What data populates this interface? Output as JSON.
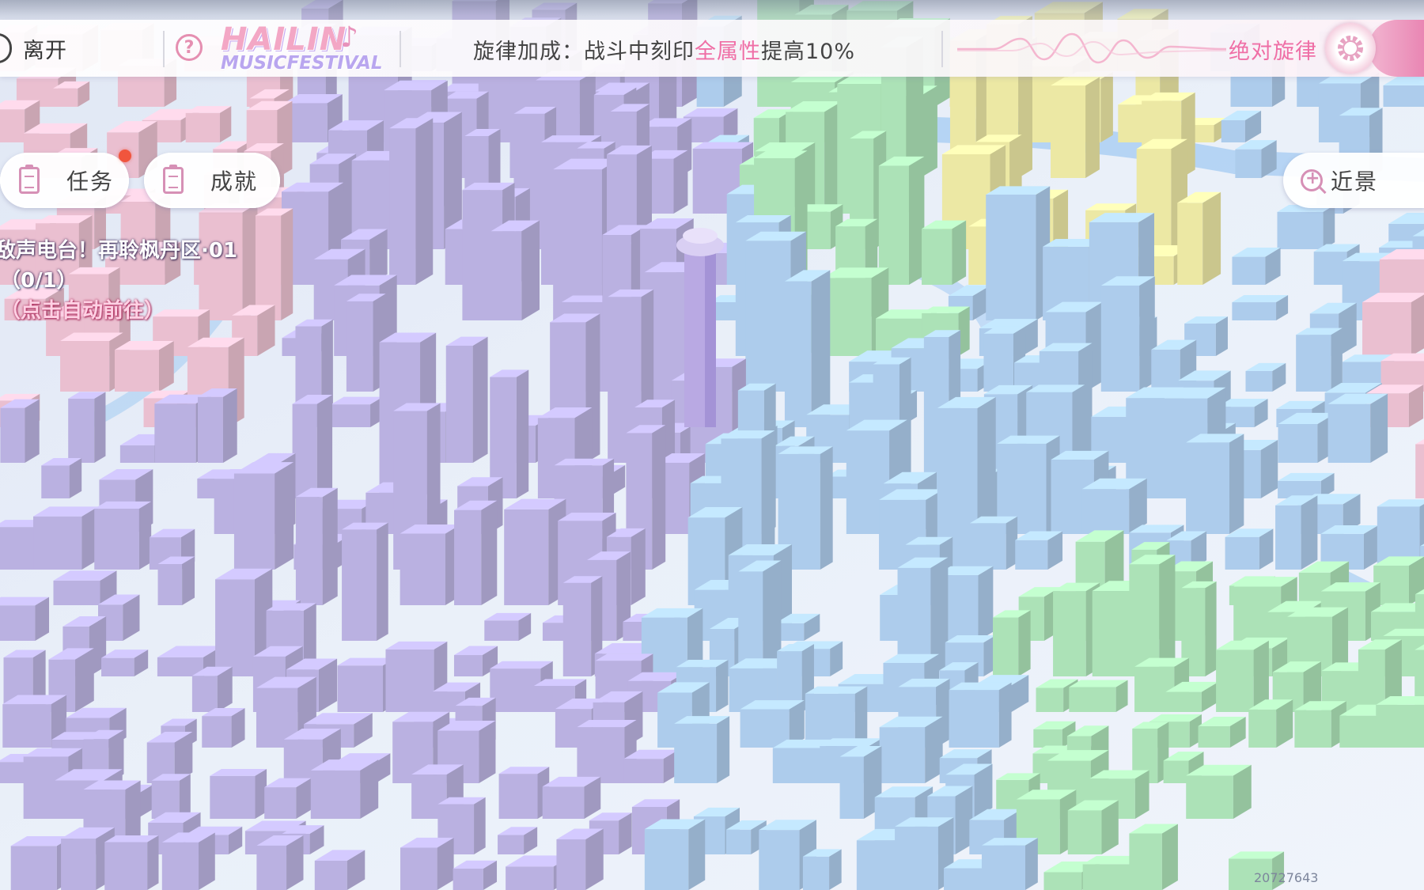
{
  "topbar": {
    "exit_label": "离开",
    "logo_line1": "HAILIN",
    "logo_line2": "MUSICFESTIVAL",
    "bonus_prefix": "旋律加成：战斗中刻印",
    "bonus_highlight": "全属性",
    "bonus_suffix": "提高10%",
    "mode_label": "绝对旋律"
  },
  "left_panel": {
    "tasks_label": "任务",
    "achievements_label": "成就",
    "quest_title": "敌声电台！再聆枫丹区·01",
    "quest_progress": "（0/1）",
    "quest_action": "（点击自动前往）"
  },
  "zoom": {
    "label": "近景"
  },
  "footer": {
    "uid": "20727643"
  },
  "colors": {
    "accent_pink": "#ef6fa6",
    "notification_red": "#f0553d",
    "district_purple": "#b8aee6",
    "district_blue": "#a9cdf4",
    "district_green": "#a8e8b4",
    "district_yellow": "#f4ef9e",
    "district_pink": "#f2bfd2"
  },
  "icons": [
    "exit-icon",
    "help-icon",
    "music-note-icon",
    "waveform-icon",
    "gear-icon",
    "clipboard-icon",
    "zoom-in-icon"
  ]
}
